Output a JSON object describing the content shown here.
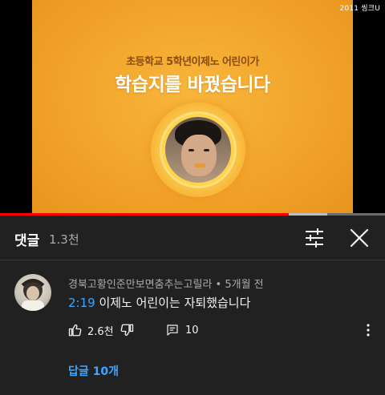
{
  "video": {
    "overlay_badge": "2011 씽크U",
    "subtitle": "초등학교 5학년이제노 어린이가",
    "title": "학습지를 바꿨습니다",
    "progress_fraction": 0.75,
    "buffered_fraction": 0.1
  },
  "comments_panel": {
    "title": "댓글",
    "count": "1.3천"
  },
  "comment": {
    "author": "경북고황인준만보면춤추는고릴라",
    "separator": " • ",
    "age": "5개월 전",
    "timestamp": "2:19",
    "text": " 이제노 어린이는 자퇴했습니다",
    "likes": "2.6천",
    "reply_count": "10",
    "replies_link": "답글 10개"
  },
  "colors": {
    "accent_link": "#3ea6ff",
    "progress_red": "#ff0000",
    "background": "#212121"
  },
  "icons": [
    "filter-icon",
    "close-icon",
    "thumbs-up-icon",
    "thumbs-down-icon",
    "comment-reply-icon",
    "more-vert-icon"
  ]
}
